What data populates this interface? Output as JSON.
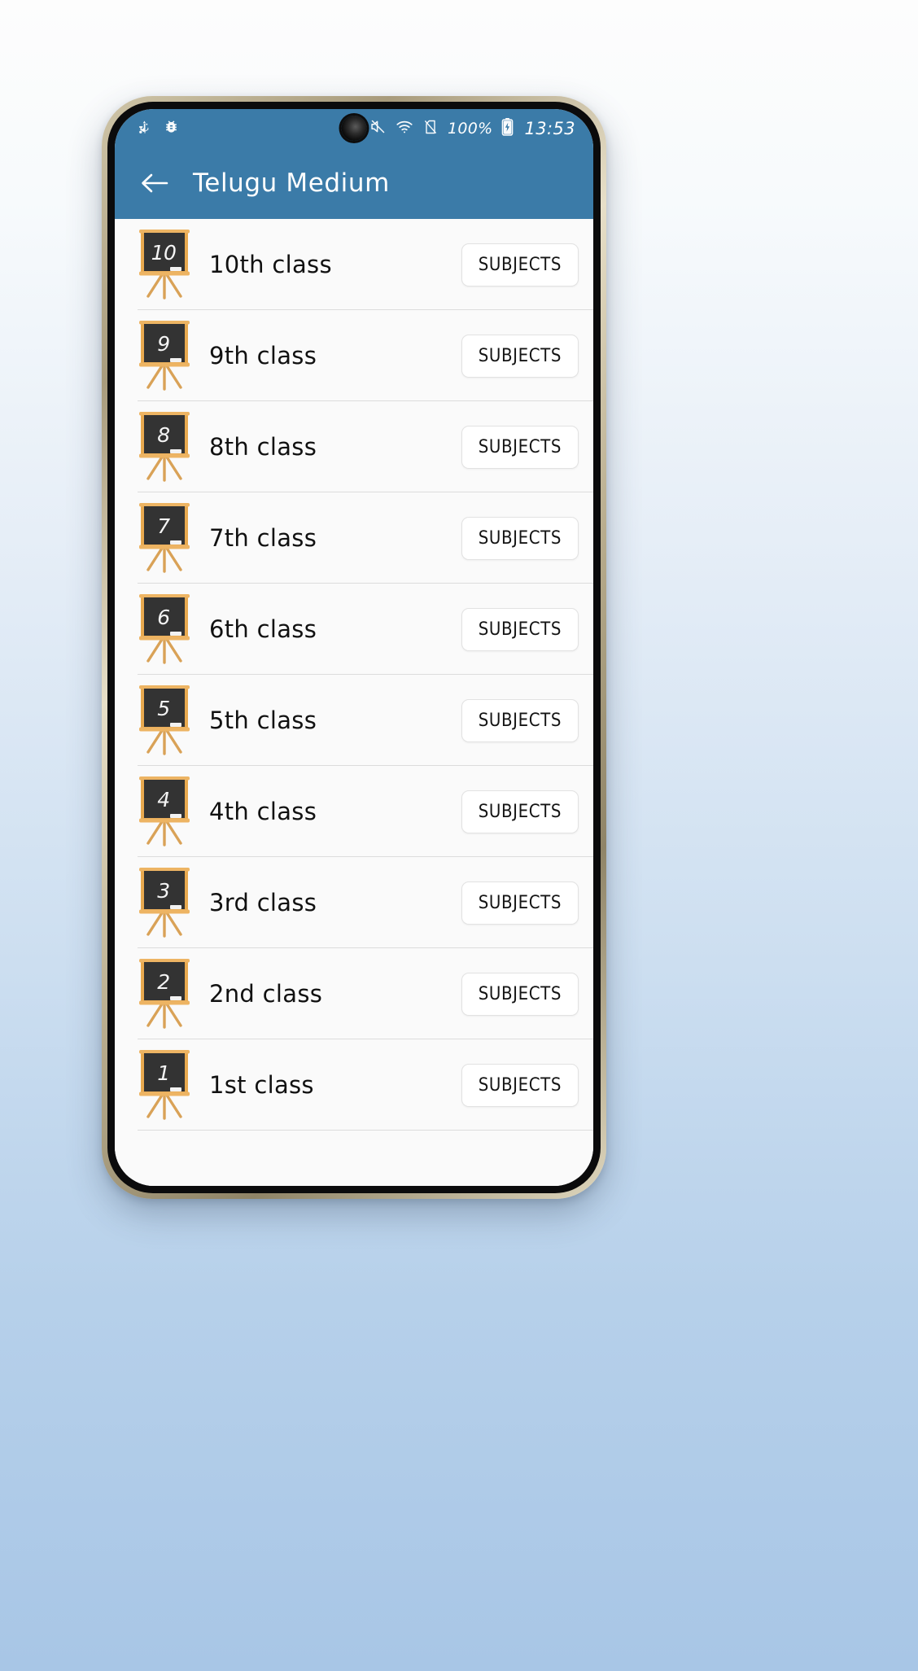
{
  "theme": {
    "appbar_color": "#3b7ba8",
    "screen_bg": "#fafafa",
    "board_color": "#333333",
    "easel_wood_color": "#e0a44a",
    "divider_color": "#dcdcdc"
  },
  "status_bar": {
    "left_icons": [
      "usb-icon",
      "bug-icon"
    ],
    "right_icons": [
      "nfc-icon",
      "volume-mute-icon",
      "wifi-icon",
      "no-sim-icon"
    ],
    "battery_percent": "100%",
    "battery_icon": "battery-charging-icon",
    "time": "13:53"
  },
  "app_bar": {
    "back_icon": "back-arrow-icon",
    "title": "Telugu Medium"
  },
  "list": {
    "button_label": "SUBJECTS",
    "rows": [
      {
        "board": "10",
        "label": "10th class"
      },
      {
        "board": "9",
        "label": "9th class"
      },
      {
        "board": "8",
        "label": "8th class"
      },
      {
        "board": "7",
        "label": "7th class"
      },
      {
        "board": "6",
        "label": "6th class"
      },
      {
        "board": "5",
        "label": "5th class"
      },
      {
        "board": "4",
        "label": "4th class"
      },
      {
        "board": "3",
        "label": "3rd class"
      },
      {
        "board": "2",
        "label": "2nd class"
      },
      {
        "board": "1",
        "label": "1st class"
      }
    ]
  }
}
